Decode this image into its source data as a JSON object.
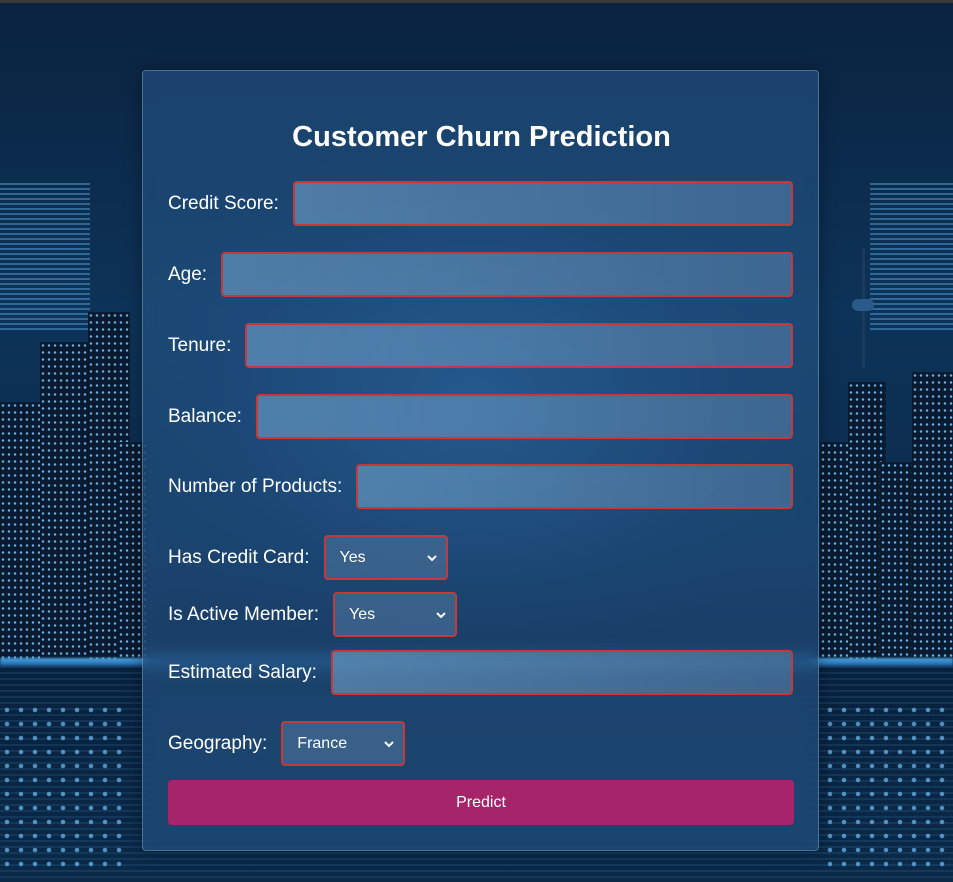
{
  "form": {
    "title": "Customer Churn Prediction",
    "fields": {
      "credit_score": {
        "label": "Credit Score:",
        "value": ""
      },
      "age": {
        "label": "Age:",
        "value": ""
      },
      "tenure": {
        "label": "Tenure:",
        "value": ""
      },
      "balance": {
        "label": "Balance:",
        "value": ""
      },
      "num_products": {
        "label": "Number of Products:",
        "value": ""
      },
      "has_credit_card": {
        "label": "Has Credit Card:",
        "selected": "Yes"
      },
      "is_active_member": {
        "label": "Is Active Member:",
        "selected": "Yes"
      },
      "estimated_salary": {
        "label": "Estimated Salary:",
        "value": ""
      },
      "geography": {
        "label": "Geography:",
        "selected": "France"
      }
    },
    "submit_label": "Predict"
  },
  "colors": {
    "accent_button": "#a6246a",
    "input_border": "#c8373a",
    "background": "#0b2c4e"
  },
  "icons": {
    "select_arrow": "chevron-down-icon"
  }
}
